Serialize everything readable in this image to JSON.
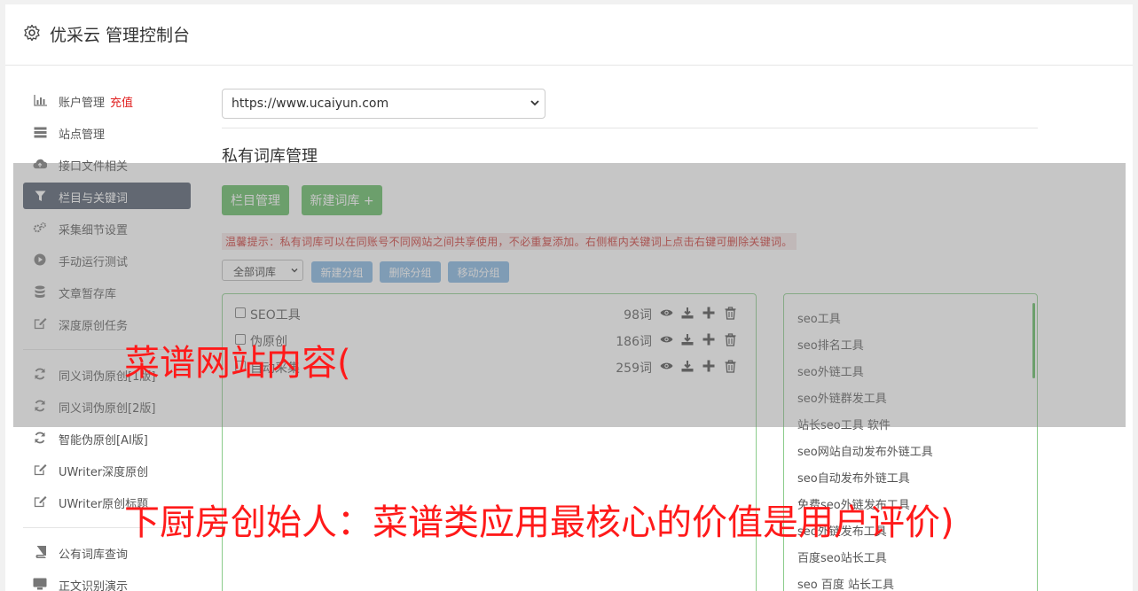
{
  "header": {
    "title": "优采云 管理控制台",
    "icon": "gear-icon"
  },
  "sidebar": {
    "items": [
      {
        "label": "账户管理",
        "extra": "充值",
        "icon": "bar-chart-icon"
      },
      {
        "label": "站点管理",
        "icon": "server-icon"
      },
      {
        "label": "接口文件相关",
        "icon": "cloud-upload-icon"
      },
      {
        "label": "栏目与关键词",
        "icon": "filter-icon",
        "active": true
      },
      {
        "label": "采集细节设置",
        "icon": "cogs-icon"
      },
      {
        "label": "手动运行测试",
        "icon": "play-circle-icon"
      },
      {
        "label": "文章暂存库",
        "icon": "database-icon"
      },
      {
        "label": "深度原创任务",
        "icon": "edit-icon"
      },
      {
        "label": "同义词伪原创[1版]",
        "icon": "refresh-icon"
      },
      {
        "label": "同义词伪原创[2版]",
        "icon": "refresh-icon"
      },
      {
        "label": "智能伪原创[AI版]",
        "icon": "refresh-icon"
      },
      {
        "label": "UWriter深度原创",
        "icon": "edit-icon"
      },
      {
        "label": "UWriter原创标题",
        "icon": "edit-icon"
      },
      {
        "label": "公有词库查询",
        "icon": "book-icon"
      },
      {
        "label": "正文识别演示",
        "icon": "desktop-icon"
      }
    ]
  },
  "main": {
    "site_select": "https://www.ucaiyun.com",
    "section_title": "私有词库管理",
    "buttons": {
      "column_manage": "栏目管理",
      "new_lexicon": "新建词库 +"
    },
    "tip": "温馨提示：私有词库可以在同账号不同网站之间共享使用，不必重复添加。右侧框内关键词上点击右键可删除关键词。",
    "filter": {
      "group_select": "全部词库",
      "new_group": "新建分组",
      "delete_group": "删除分组",
      "move_group": "移动分组"
    },
    "lexicons": [
      {
        "name": "SEO工具",
        "count": "98词"
      },
      {
        "name": "伪原创",
        "count": "186词"
      },
      {
        "name": "自动采集",
        "count": "259词"
      }
    ],
    "keywords": [
      "seo工具",
      "seo排名工具",
      "seo外链工具",
      "seo外链群发工具",
      "站长seo工具 软件",
      "seo网站自动发布外链工具",
      "seo自动发布外链工具",
      "免费seo外链发布工具",
      "seo外链发布工具",
      "百度seo站长工具",
      "seo 百度 站长工具"
    ]
  },
  "overlay": {
    "line1": "菜谱网站内容(",
    "line2": "下厨房创始人：菜谱类应用最核心的价值是用户评价)"
  },
  "colors": {
    "accent_green": "#5cb85c",
    "active_nav": "#4a5566",
    "tip_red": "#c9302c",
    "overlay_red": "#ff1a1a"
  }
}
